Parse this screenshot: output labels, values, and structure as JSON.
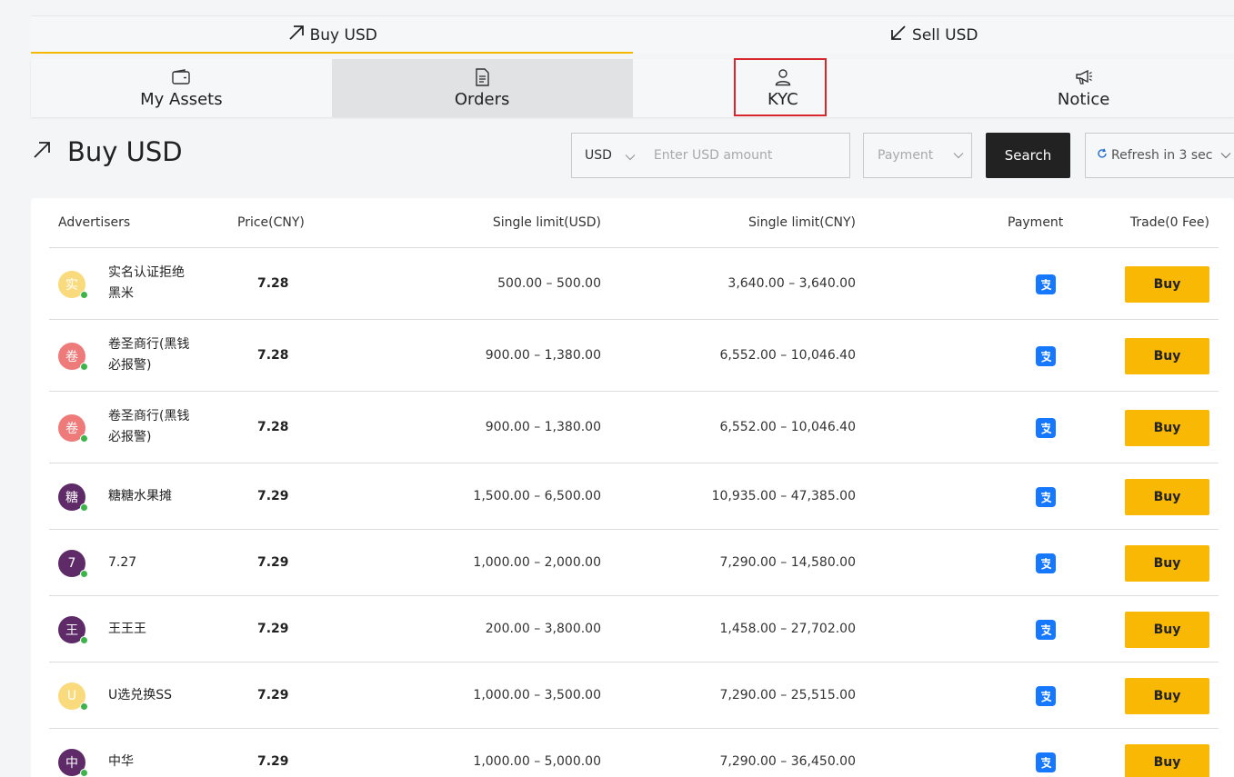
{
  "trade_tabs": [
    {
      "label": "Buy USD",
      "icon": "arrow-up-right-icon",
      "active": true
    },
    {
      "label": "Sell USD",
      "icon": "arrow-down-left-icon",
      "active": false
    }
  ],
  "subnav": [
    {
      "label": "My Assets",
      "icon": "wallet-icon",
      "active": false
    },
    {
      "label": "Orders",
      "icon": "document-icon",
      "active": true
    },
    {
      "label": "KYC",
      "icon": "user-icon",
      "active": false,
      "highlighted": true
    },
    {
      "label": "Notice",
      "icon": "megaphone-icon",
      "active": false
    }
  ],
  "heading": {
    "title": "Buy USD",
    "icon": "arrow-up-right-icon"
  },
  "filters": {
    "currency": "USD",
    "amount_placeholder": "Enter USD amount",
    "amount_value": "",
    "payment_placeholder": "Payment",
    "search_label": "Search",
    "refresh_label": "Refresh in 3 sec"
  },
  "table": {
    "headers": {
      "advertisers": "Advertisers",
      "price": "Price(CNY)",
      "limit_usd": "Single limit(USD)",
      "limit_cny": "Single limit(CNY)",
      "payment": "Payment",
      "trade": "Trade(0 Fee)"
    },
    "buy_label": "Buy",
    "payment_icon": "alipay-icon",
    "rows": [
      {
        "avatar": "实",
        "avatar_color": "#f9db7d",
        "name": "实名认证拒绝黑米",
        "price": "7.28",
        "limit_usd": "500.00 – 500.00",
        "limit_cny": "3,640.00 – 3,640.00"
      },
      {
        "avatar": "卷",
        "avatar_color": "#ee7a7a",
        "name": "卷圣商行(黑钱必报警)",
        "price": "7.28",
        "limit_usd": "900.00 – 1,380.00",
        "limit_cny": "6,552.00 – 10,046.40"
      },
      {
        "avatar": "卷",
        "avatar_color": "#ee7a7a",
        "name": "卷圣商行(黑钱必报警)",
        "price": "7.28",
        "limit_usd": "900.00 – 1,380.00",
        "limit_cny": "6,552.00 – 10,046.40"
      },
      {
        "avatar": "糖",
        "avatar_color": "#5e2a68",
        "name": "糖糖水果摊",
        "price": "7.29",
        "limit_usd": "1,500.00 – 6,500.00",
        "limit_cny": "10,935.00 – 47,385.00"
      },
      {
        "avatar": "7",
        "avatar_color": "#5e2a68",
        "name": "7.27",
        "price": "7.29",
        "limit_usd": "1,000.00 – 2,000.00",
        "limit_cny": "7,290.00 – 14,580.00"
      },
      {
        "avatar": "王",
        "avatar_color": "#5e2a68",
        "name": "王王王",
        "price": "7.29",
        "limit_usd": "200.00 – 3,800.00",
        "limit_cny": "1,458.00 – 27,702.00"
      },
      {
        "avatar": "U",
        "avatar_color": "#f9db7d",
        "name": "U选兑换SS",
        "price": "7.29",
        "limit_usd": "1,000.00 – 3,500.00",
        "limit_cny": "7,290.00 – 25,515.00"
      },
      {
        "avatar": "中",
        "avatar_color": "#5e2a68",
        "name": "中华",
        "price": "7.29",
        "limit_usd": "1,000.00 – 5,000.00",
        "limit_cny": "7,290.00 – 36,450.00"
      }
    ]
  }
}
